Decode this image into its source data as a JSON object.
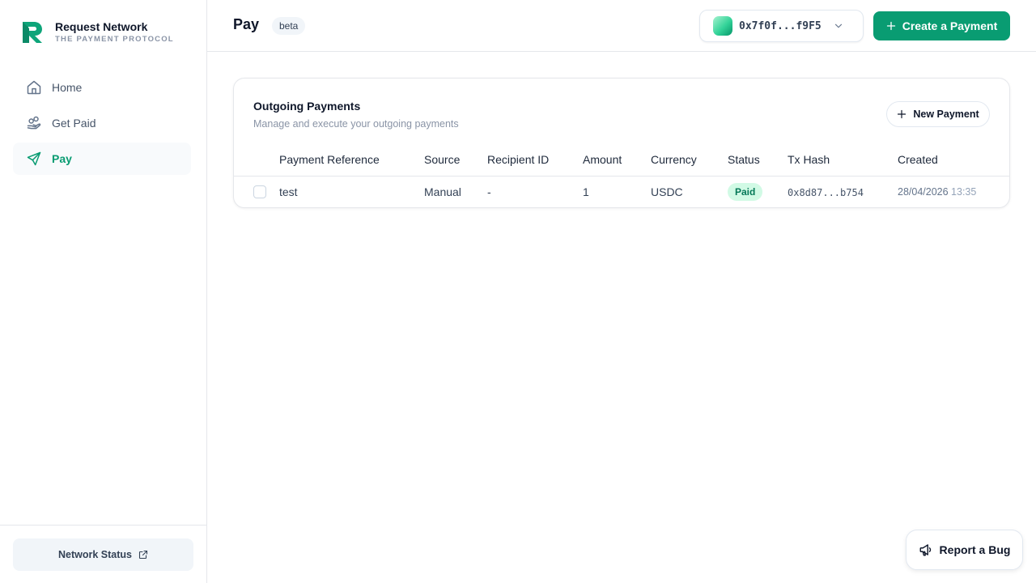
{
  "brand": {
    "name": "Request Network",
    "tagline": "THE PAYMENT PROTOCOL"
  },
  "nav": {
    "items": [
      {
        "label": "Home",
        "icon": "home-icon"
      },
      {
        "label": "Get Paid",
        "icon": "hand-coins-icon"
      },
      {
        "label": "Pay",
        "icon": "send-icon",
        "active": true
      }
    ]
  },
  "sidebar_footer": {
    "network_status": "Network Status"
  },
  "header": {
    "title": "Pay",
    "badge": "beta",
    "wallet_address": "0x7f0f...f9F5",
    "create_label": "Create a Payment"
  },
  "card": {
    "title": "Outgoing Payments",
    "subtitle": "Manage and execute your outgoing payments",
    "new_label": "New Payment"
  },
  "table": {
    "columns": [
      "Payment Reference",
      "Source",
      "Recipient ID",
      "Amount",
      "Currency",
      "Status",
      "Tx Hash",
      "Created"
    ],
    "rows": [
      {
        "reference": "test",
        "source": "Manual",
        "recipient": "-",
        "amount": "1",
        "currency": "USDC",
        "status": "Paid",
        "tx_hash": "0x8d87...b754",
        "created_date": "28/04/2026",
        "created_time": "13:35"
      }
    ]
  },
  "report": {
    "label": "Report a Bug"
  },
  "colors": {
    "accent": "#099c72",
    "paid_bg": "#d1fae5",
    "paid_text": "#047857"
  }
}
